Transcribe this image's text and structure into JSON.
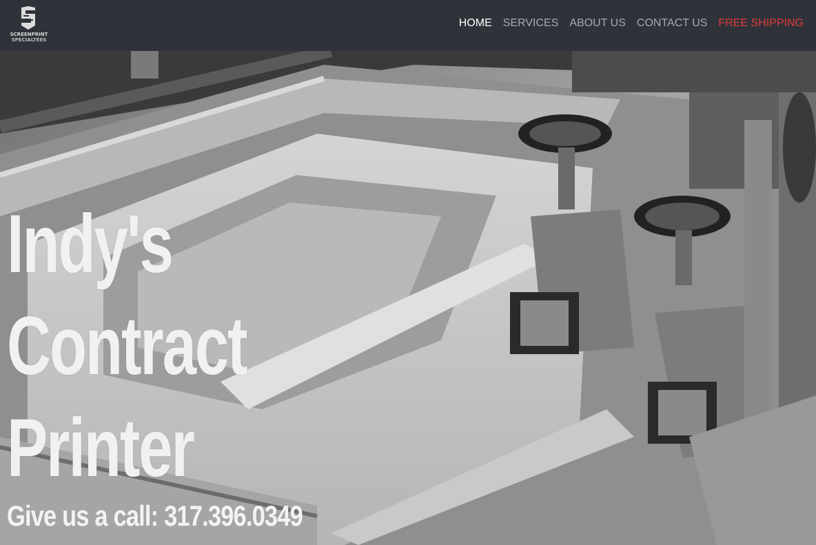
{
  "brand": {
    "logo_icon": "ss-logo-icon",
    "word1": "SCREENPRINT",
    "word2": "SPECIALTEES"
  },
  "nav": {
    "items": [
      {
        "label": "HOME",
        "state": "active"
      },
      {
        "label": "SERVICES",
        "state": "normal"
      },
      {
        "label": "ABOUT US",
        "state": "normal"
      },
      {
        "label": "CONTACT US",
        "state": "normal"
      },
      {
        "label": "FREE SHIPPING",
        "state": "promo"
      }
    ]
  },
  "hero": {
    "headline": [
      "Indy's",
      "Contract",
      "Printer"
    ],
    "callout": "Give us a call: 317.396.0349",
    "background": "screen-printing-press-photo"
  },
  "colors": {
    "topbar": "#2f3339",
    "nav_text": "#a7abb0",
    "nav_active": "#ffffff",
    "promo": "#e0383b",
    "hero_text": "#f1f1f1"
  }
}
